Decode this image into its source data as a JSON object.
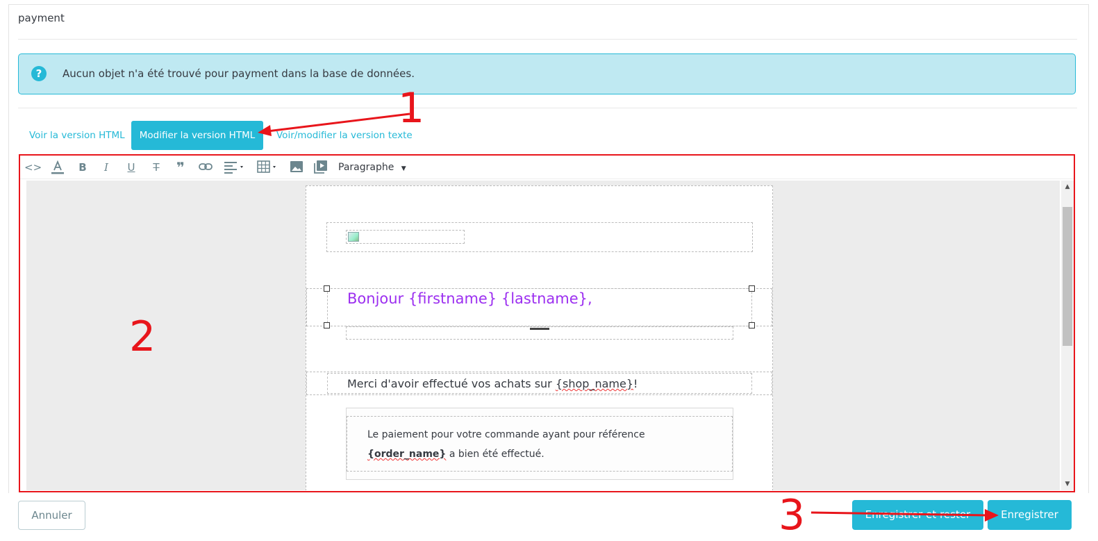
{
  "panel": {
    "title": "payment"
  },
  "alert": {
    "icon": "question-circle-icon",
    "message": "Aucun objet n'a été trouvé pour payment dans la base de données."
  },
  "tabs": [
    {
      "label": "Voir la version HTML",
      "active": false
    },
    {
      "label": "Modifier la version HTML",
      "active": true
    },
    {
      "label": "Voir/modifier la version texte",
      "active": false
    }
  ],
  "toolbar": {
    "buttons": [
      "code-icon",
      "text-color-icon",
      "bold-icon",
      "italic-icon",
      "underline-icon",
      "strikethrough-icon",
      "blockquote-icon",
      "link-icon",
      "align-icon",
      "table-icon",
      "image-icon",
      "media-icon"
    ],
    "format_select": "Paragraphe"
  },
  "email": {
    "greeting": "Bonjour {firstname} {lastname},",
    "thanks_prefix": "Merci d'avoir effectué vos achats sur ",
    "thanks_shop": "{shop_name}",
    "thanks_suffix": "!",
    "payment_line1": "Le paiement pour votre commande ayant pour référence",
    "payment_order": "{order_name}",
    "payment_line2": " a bien été effectué."
  },
  "annotations": {
    "n1": "1",
    "n2": "2",
    "n3": "3"
  },
  "footer": {
    "cancel_label": "Annuler",
    "save_stay_label": "Enregistrer et rester",
    "save_label": "Enregistrer"
  },
  "colors": {
    "accent": "#25b9d7",
    "alert_bg": "#bfe9f2",
    "greeting": "#9c2ff0",
    "annotation": "#e8151b"
  }
}
